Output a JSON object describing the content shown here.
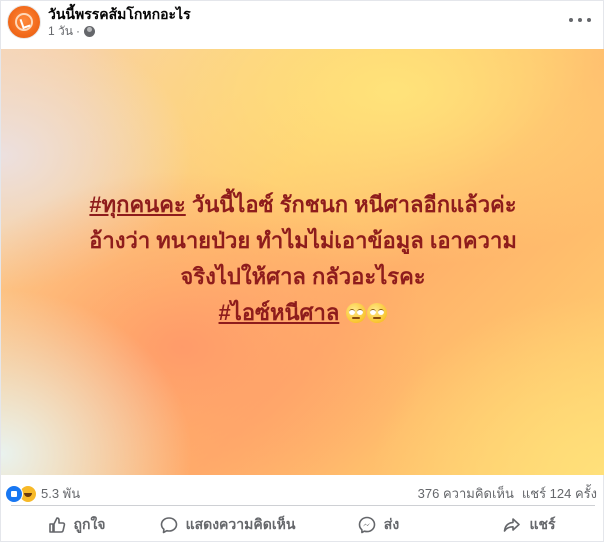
{
  "post": {
    "page_name": "วันนี้พรรคส้มโกหกอะไร",
    "time": "1 วัน",
    "separator": "·",
    "privacy_icon": "globe-icon",
    "more_icon": "more-horizontal-icon"
  },
  "media": {
    "hashtag_1": "#ทุกคนคะ",
    "line_1_rest": " วันนี้ไอซ์ รักชนก หนีศาลอีกแล้วค่ะ",
    "line_2": "อ้างว่า ทนายป่วย ทำไมไม่เอาข้อมูล เอาความ",
    "line_3": "จริงไปให้ศาล กลัวอะไรคะ",
    "hashtag_2": "#ไอซ์หนีศาล",
    "emoji": "face-with-rolling-eyes"
  },
  "stats": {
    "reaction_count": "5.3 พัน",
    "reaction_icons": [
      "like-icon",
      "haha-icon"
    ],
    "comments": "376 ความคิดเห็น",
    "shares": "แชร์ 124 ครั้ง"
  },
  "actions": {
    "like": "ถูกใจ",
    "comment": "แสดงความคิดเห็น",
    "send": "ส่ง",
    "share": "แชร์"
  },
  "colors": {
    "text_primary": "#050505",
    "text_secondary": "#65676b",
    "media_text": "#8e1c1c",
    "like_blue": "#1877f2",
    "avatar_orange": "#f26a1b"
  }
}
